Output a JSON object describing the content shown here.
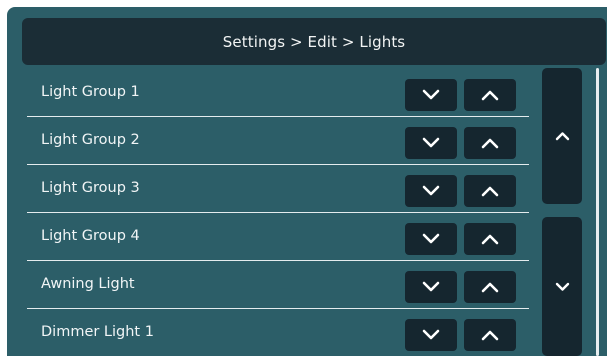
{
  "header": {
    "title": "Settings > Edit > Lights"
  },
  "rows": [
    {
      "label": "Light Group 1"
    },
    {
      "label": "Light Group 2"
    },
    {
      "label": "Light Group 3"
    },
    {
      "label": "Light Group 4"
    },
    {
      "label": "Awning Light"
    },
    {
      "label": "Dimmer Light 1"
    }
  ],
  "icons": {
    "row_down": "chevron-down-icon",
    "row_up": "chevron-up-icon",
    "scroll_up": "chevron-up-icon",
    "scroll_down": "chevron-down-icon"
  },
  "colors": {
    "background": "#2c5e68",
    "header": "#1b2d36",
    "button": "#15262f",
    "text": "#f1f5f6"
  }
}
